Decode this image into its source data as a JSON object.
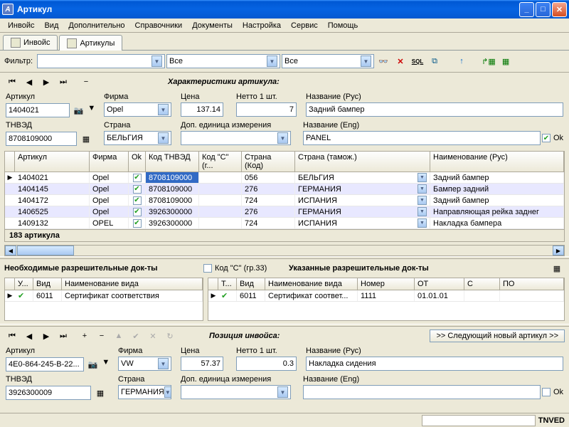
{
  "window": {
    "title": "Артикул"
  },
  "menu": [
    "Инвойс",
    "Вид",
    "Дополнительно",
    "Справочники",
    "Документы",
    "Настройка",
    "Сервис",
    "Помощь"
  ],
  "tabs": [
    {
      "label": "Инвойс"
    },
    {
      "label": "Артикулы"
    }
  ],
  "filter": {
    "label": "Фильтр:",
    "combo1": "Все",
    "combo2": "Все"
  },
  "section1": {
    "header": "Характеристики артикула:",
    "artikul_label": "Артикул",
    "artikul_val": "1404021",
    "firma_label": "Фирма",
    "firma_val": "Opel",
    "cena_label": "Цена",
    "cena_val": "137.14",
    "netto_label": "Нетто 1 шт.",
    "netto_val": "7",
    "nameru_label": "Название (Рус)",
    "nameru_val": "Задний бампер",
    "tnved_label": "ТНВЭД",
    "tnved_val": "8708109000",
    "strana_label": "Страна",
    "strana_val": "БЕЛЬГИЯ",
    "dop_label": "Доп. единица измерения",
    "dop_val": "",
    "nameen_label": "Название (Eng)",
    "nameen_val": "PANEL",
    "ok_label": "Ok"
  },
  "grid1": {
    "cols": [
      "Артикул",
      "Фирма",
      "Ok",
      "Код ТНВЭД",
      "Код \"С\" (г...",
      "Страна (Код)",
      "Страна (тамож.)",
      "Наименование (Рус)"
    ],
    "rows": [
      {
        "a": "1404021",
        "f": "Opel",
        "ok": true,
        "t": "8708109000",
        "c": "",
        "sk": "056",
        "st": "БЕЛЬГИЯ",
        "n": "Задний бампер",
        "sel": true
      },
      {
        "a": "1404145",
        "f": "Opel",
        "ok": true,
        "t": "8708109000",
        "c": "",
        "sk": "276",
        "st": "ГЕРМАНИЯ",
        "n": "Бампер задний"
      },
      {
        "a": "1404172",
        "f": "Opel",
        "ok": true,
        "t": "8708109000",
        "c": "",
        "sk": "724",
        "st": "ИСПАНИЯ",
        "n": "Задний бампер"
      },
      {
        "a": "1406525",
        "f": "Opel",
        "ok": true,
        "t": "3926300000",
        "c": "",
        "sk": "276",
        "st": "ГЕРМАНИЯ",
        "n": "Направляющая рейка заднег"
      },
      {
        "a": "1409132",
        "f": "OPEL",
        "ok": true,
        "t": "3926300000",
        "c": "",
        "sk": "724",
        "st": "ИСПАНИЯ",
        "n": "Накладка бампера"
      }
    ],
    "footer": "183 артикула"
  },
  "perms": {
    "left_header": "Необходимые разрешительные док-ты",
    "kod_c_label": "Код \"С\" (гр.33)",
    "right_header": "Указанные разрешительные док-ты",
    "left_cols": [
      "У...",
      "Вид",
      "Наименование вида"
    ],
    "right_cols": [
      "Т...",
      "Вид",
      "Наименование вида",
      "Номер",
      "ОТ",
      "С",
      "ПО"
    ],
    "left_row": {
      "u": "✔",
      "vid": "6011",
      "name": "Сертификат соответствия"
    },
    "right_row": {
      "t": "✔",
      "vid": "6011",
      "name": "Сертификат соответ...",
      "nomer": "1111",
      "ot": "01.01.01",
      "s": "",
      "po": ""
    }
  },
  "section2": {
    "header": "Позиция инвойса:",
    "next_btn": ">> Следующий новый артикул >>",
    "artikul_label": "Артикул",
    "artikul_val": "4E0-864-245-B-22...",
    "firma_label": "Фирма",
    "firma_val": "VW",
    "cena_label": "Цена",
    "cena_val": "57.37",
    "netto_label": "Нетто 1 шт.",
    "netto_val": "0.3",
    "nameru_label": "Название (Рус)",
    "nameru_val": "Накладка сидения",
    "tnved_label": "ТНВЭД",
    "tnved_val": "3926300009",
    "strana_label": "Страна",
    "strana_val": "ГЕРМАНИЯ",
    "dop_label": "Доп. единица измерения",
    "dop_val": "",
    "nameen_label": "Название (Eng)",
    "nameen_val": "",
    "ok_label": "Ok"
  },
  "status": {
    "tnved": "TNVED"
  },
  "icons": {
    "binoculars": "🔍",
    "delete": "✕",
    "sql": "SQL",
    "tree": "⧉",
    "up": "↑",
    "excel": "⇢▦",
    "xls": "▦"
  }
}
